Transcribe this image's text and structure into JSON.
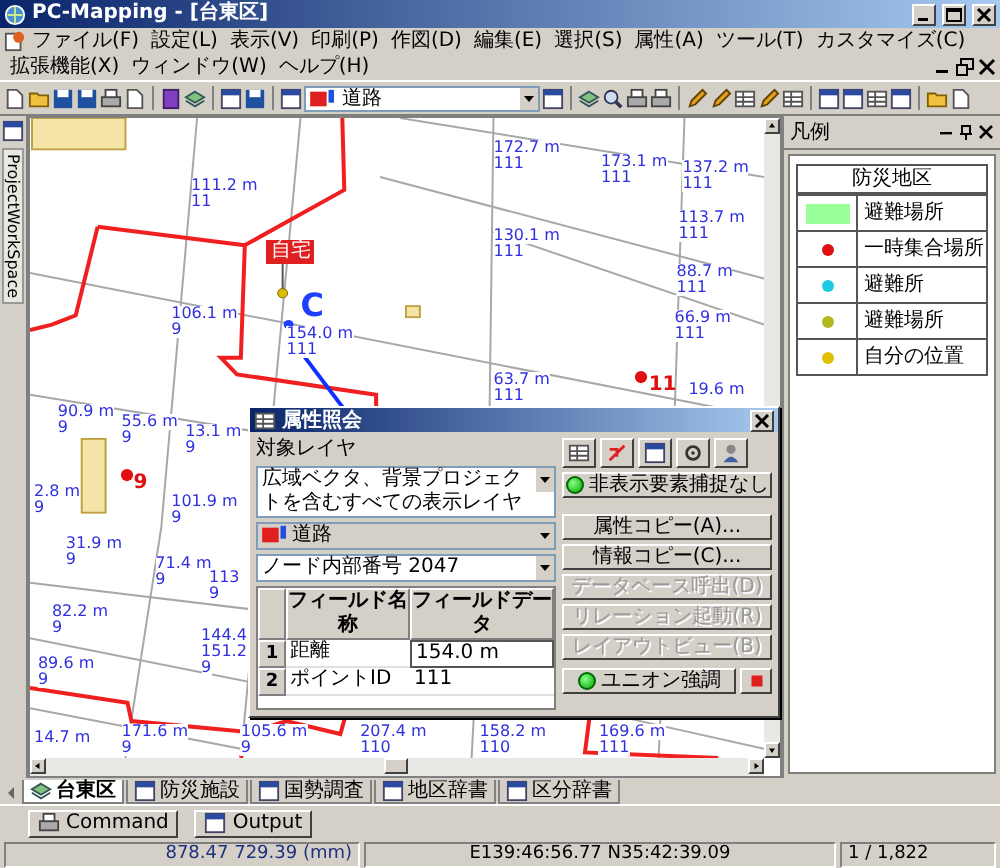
{
  "window": {
    "title": "PC-Mapping - [台東区]"
  },
  "menu": [
    "ファイル(F)",
    "設定(L)",
    "表示(V)",
    "印刷(P)",
    "作図(D)",
    "編集(E)",
    "選択(S)",
    "属性(A)",
    "ツール(T)",
    "カスタマイズ(C)",
    "拡張機能(X)",
    "ウィンドウ(W)",
    "ヘルプ(H)"
  ],
  "toolbar": {
    "layer_combo": "道路"
  },
  "workspace_tab": "ProjectWorkSpace",
  "map": {
    "labels": [
      {
        "length": "172.7 m",
        "id": "111"
      },
      {
        "length": "173.1 m",
        "id": "111"
      },
      {
        "length": "137.2 m",
        "id": "111"
      },
      {
        "length": "111.2 m",
        "id": "11"
      },
      {
        "length": "130.1 m",
        "id": "111"
      },
      {
        "length": "113.7 m",
        "id": "111"
      },
      {
        "length": "88.7 m",
        "id": "111"
      },
      {
        "length": "106.1 m",
        "id": "9"
      },
      {
        "length": "154.0 m",
        "id": "111"
      },
      {
        "length": "66.9 m",
        "id": "111"
      },
      {
        "length": "63.7 m",
        "id": "111"
      },
      {
        "length": "90.9 m",
        "id": "9"
      },
      {
        "length": "55.6 m",
        "id": "9"
      },
      {
        "length": "13.1 m",
        "id": "9"
      },
      {
        "length": "19.6 m"
      },
      {
        "length": "2.8 m",
        "id": "9"
      },
      {
        "length": "101.9 m",
        "id": "9"
      },
      {
        "length": "31.9 m",
        "id": "9"
      },
      {
        "length": "71.4 m",
        "id": "9"
      },
      {
        "length": "113",
        "id": "9"
      },
      {
        "length": "82.2 m",
        "id": "9"
      },
      {
        "length": "144.4"
      },
      {
        "length": "151.2",
        "id": "9"
      },
      {
        "length": "89.6 m",
        "id": "9"
      },
      {
        "length": "14.7 m"
      },
      {
        "length": "171.6 m",
        "id": "9"
      },
      {
        "length": "105.6 m",
        "id": "9"
      },
      {
        "length": "207.4 m",
        "id": "110"
      },
      {
        "length": "158.2 m",
        "id": "110"
      },
      {
        "length": "169.6 m",
        "id": "111"
      }
    ],
    "markers": [
      {
        "kind": "tag",
        "text": "自宅"
      },
      {
        "kind": "letter",
        "text": "C"
      },
      {
        "kind": "pin",
        "text": "11"
      },
      {
        "kind": "pin",
        "text": "9"
      }
    ]
  },
  "attribute_dialog": {
    "title": "属性照会",
    "target_layer_label": "対象レイヤ",
    "target_layer": "広域ベクタ、背景プロジェクトを含むすべての表示レイヤ",
    "layer": "道路",
    "node": "ノード内部番号 2047",
    "hidden_capture": "非表示要素捕捉なし",
    "columns": [
      "フィールド名称",
      "フィールドデータ"
    ],
    "rows": [
      {
        "num": "1",
        "name": "距離",
        "value": "154.0 m"
      },
      {
        "num": "2",
        "name": "ポイントID",
        "value": "111"
      }
    ],
    "buttons": [
      {
        "label": "属性コピー(A)...",
        "disabled": false
      },
      {
        "label": "情報コピー(C)...",
        "disabled": false
      },
      {
        "label": "データベース呼出(D)",
        "disabled": true
      },
      {
        "label": "リレーション起動(R)",
        "disabled": true
      },
      {
        "label": "レイアウトビュー(B)",
        "disabled": true
      }
    ],
    "union_button": "ユニオン強調"
  },
  "legend": {
    "title": "凡例",
    "group": "防災地区",
    "items": [
      {
        "kind": "area",
        "label": "避難場所",
        "color": "#99ff99"
      },
      {
        "kind": "dot",
        "label": "一時集合場所",
        "color": "#e01010"
      },
      {
        "kind": "dot",
        "label": "避難所",
        "color": "#20c8e0"
      },
      {
        "kind": "dot",
        "label": "避難場所",
        "color": "#b4b820"
      },
      {
        "kind": "dot",
        "label": "自分の位置",
        "color": "#e0c000"
      }
    ]
  },
  "doc_tabs": [
    {
      "label": "台東区",
      "selected": true
    },
    {
      "label": "防災施設",
      "selected": false
    },
    {
      "label": "国勢調査",
      "selected": false
    },
    {
      "label": "地区辞書",
      "selected": false
    },
    {
      "label": "区分辞書",
      "selected": false
    }
  ],
  "panels": [
    "Command",
    "Output"
  ],
  "status_bar": {
    "coords": "878.47 729.39 (mm)",
    "latlon": "E139:46:56.77 N35:42:39.09",
    "count": "1 / 1,822"
  }
}
